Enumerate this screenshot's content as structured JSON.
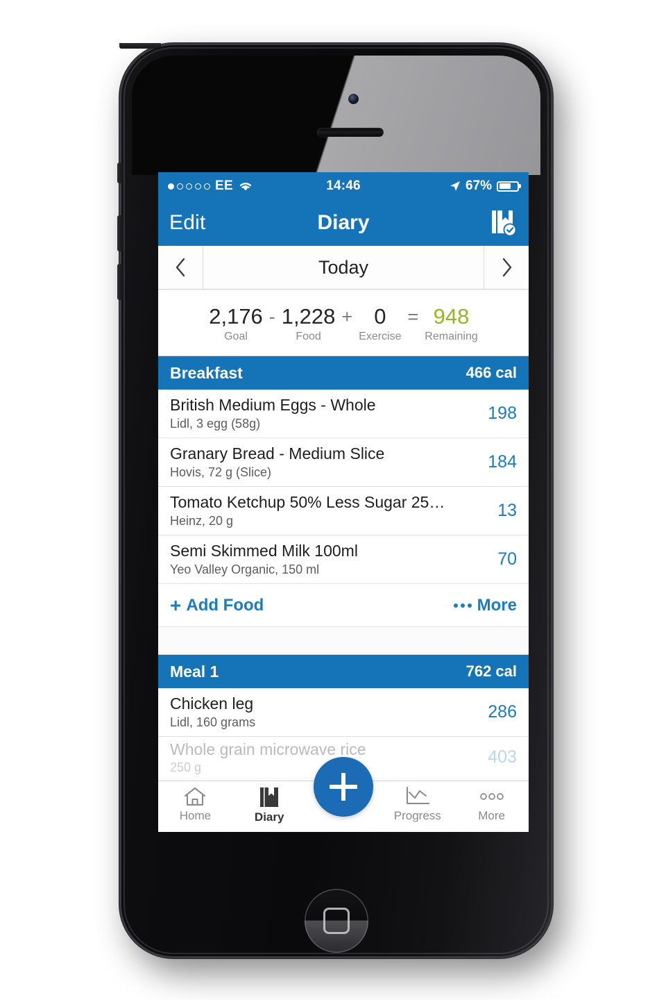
{
  "status_bar": {
    "carrier": "EE",
    "signal_bars_filled": 1,
    "signal_bars_total": 5,
    "wifi_icon": "wifi-icon",
    "time": "14:46",
    "location_icon": "location-arrow-icon",
    "battery_percent": "67%",
    "battery_level": 67
  },
  "nav_bar": {
    "edit_label": "Edit",
    "title": "Diary",
    "right_icon": "diary-complete-icon"
  },
  "date_nav": {
    "prev_icon": "chevron-left-icon",
    "label": "Today",
    "next_icon": "chevron-right-icon"
  },
  "summary": {
    "goal": {
      "value": "2,176",
      "label": "Goal"
    },
    "op1": "-",
    "food": {
      "value": "1,228",
      "label": "Food"
    },
    "op2": "+",
    "exercise": {
      "value": "0",
      "label": "Exercise"
    },
    "op3": "=",
    "remaining": {
      "value": "948",
      "label": "Remaining",
      "color": "#97B721"
    }
  },
  "meals": [
    {
      "name": "Breakfast",
      "calories": "466 cal",
      "items": [
        {
          "name": "British Medium Eggs - Whole",
          "detail": "Lidl, 3 egg (58g)",
          "calories": "198"
        },
        {
          "name": "Granary Bread - Medium Slice",
          "detail": "Hovis, 72 g (Slice)",
          "calories": "184"
        },
        {
          "name": "Tomato Ketchup 50% Less Sugar 25…",
          "detail": "Heinz, 20 g",
          "calories": "13"
        },
        {
          "name": "Semi Skimmed Milk 100ml",
          "detail": "Yeo Valley Organic, 150 ml",
          "calories": "70"
        }
      ],
      "add_food_label": "Add Food",
      "more_label": "More"
    },
    {
      "name": "Meal 1",
      "calories": "762 cal",
      "items": [
        {
          "name": "Chicken leg",
          "detail": "Lidl, 160 grams",
          "calories": "286"
        },
        {
          "name": "Whole grain microwave rice",
          "detail": "250 g",
          "calories": "403"
        }
      ]
    }
  ],
  "tab_bar": {
    "tabs": [
      {
        "label": "Home",
        "icon": "home-icon",
        "active": false
      },
      {
        "label": "Diary",
        "icon": "book-icon",
        "active": true
      },
      {
        "label": "Progress",
        "icon": "chart-line-icon",
        "active": false
      },
      {
        "label": "More",
        "icon": "ellipsis-icon",
        "active": false
      }
    ],
    "fab_icon": "plus-icon"
  },
  "theme": {
    "header_blue": "#1574B8",
    "link_blue": "#1A7CC2",
    "fab_blue": "#1B6BB5",
    "remaining_green": "#97B721"
  }
}
